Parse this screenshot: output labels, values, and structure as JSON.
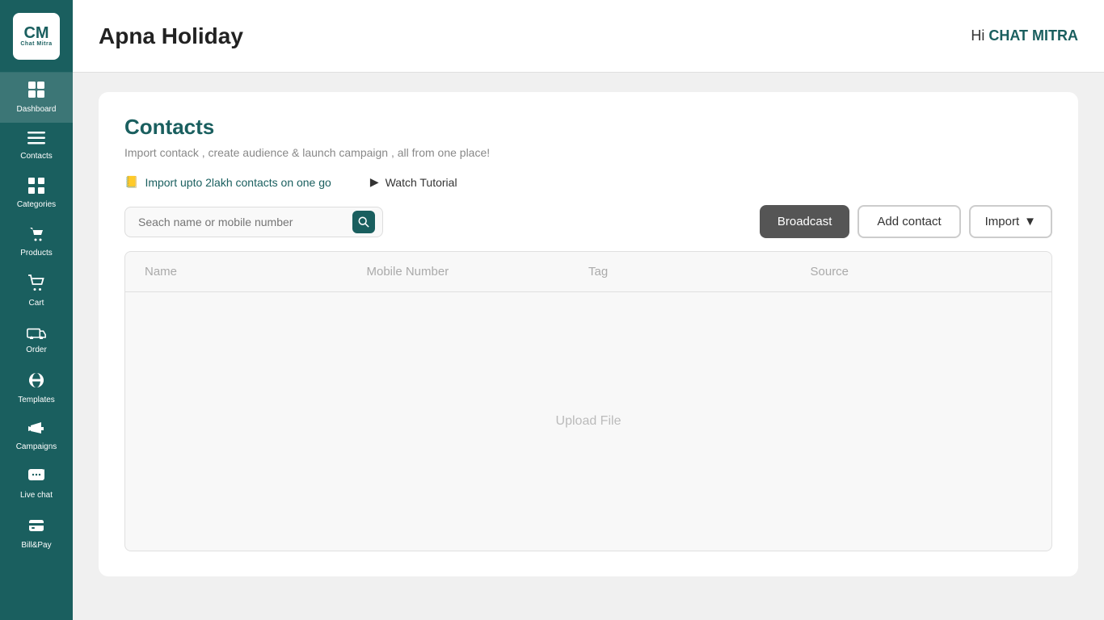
{
  "app": {
    "logo_cm": "CM",
    "logo_sub": "Chat Mitra"
  },
  "header": {
    "title": "Apna Holiday",
    "greeting_pre": "Hi ",
    "greeting_name": "CHAT MITRA"
  },
  "sidebar": {
    "items": [
      {
        "id": "dashboard",
        "label": "Dashboard",
        "icon": "⊞"
      },
      {
        "id": "contacts",
        "label": "Contacts",
        "icon": "≡"
      },
      {
        "id": "categories",
        "label": "Categories",
        "icon": "☰"
      },
      {
        "id": "products",
        "label": "Products",
        "icon": "🏷"
      },
      {
        "id": "cart",
        "label": "Cart",
        "icon": "🛒"
      },
      {
        "id": "order",
        "label": "Order",
        "icon": "🚚"
      },
      {
        "id": "templates",
        "label": "Templates",
        "icon": "💬"
      },
      {
        "id": "campaigns",
        "label": "Campaigns",
        "icon": "📢"
      },
      {
        "id": "live-chat",
        "label": "Live chat",
        "icon": "💬"
      },
      {
        "id": "bill-pay",
        "label": "Bill&Pay",
        "icon": "💳"
      }
    ]
  },
  "contacts_page": {
    "title": "Contacts",
    "subtitle": "Import contack , create audience & launch campaign , all from one place!",
    "import_link": "Import upto 2lakh contacts on one go",
    "watch_tutorial": "Watch Tutorial",
    "search_placeholder": "Seach name or mobile number",
    "btn_broadcast": "Broadcast",
    "btn_add_contact": "Add contact",
    "btn_import": "Import",
    "table": {
      "columns": [
        "Name",
        "Mobile Number",
        "Tag",
        "Source"
      ],
      "empty_label": "Upload File"
    }
  }
}
